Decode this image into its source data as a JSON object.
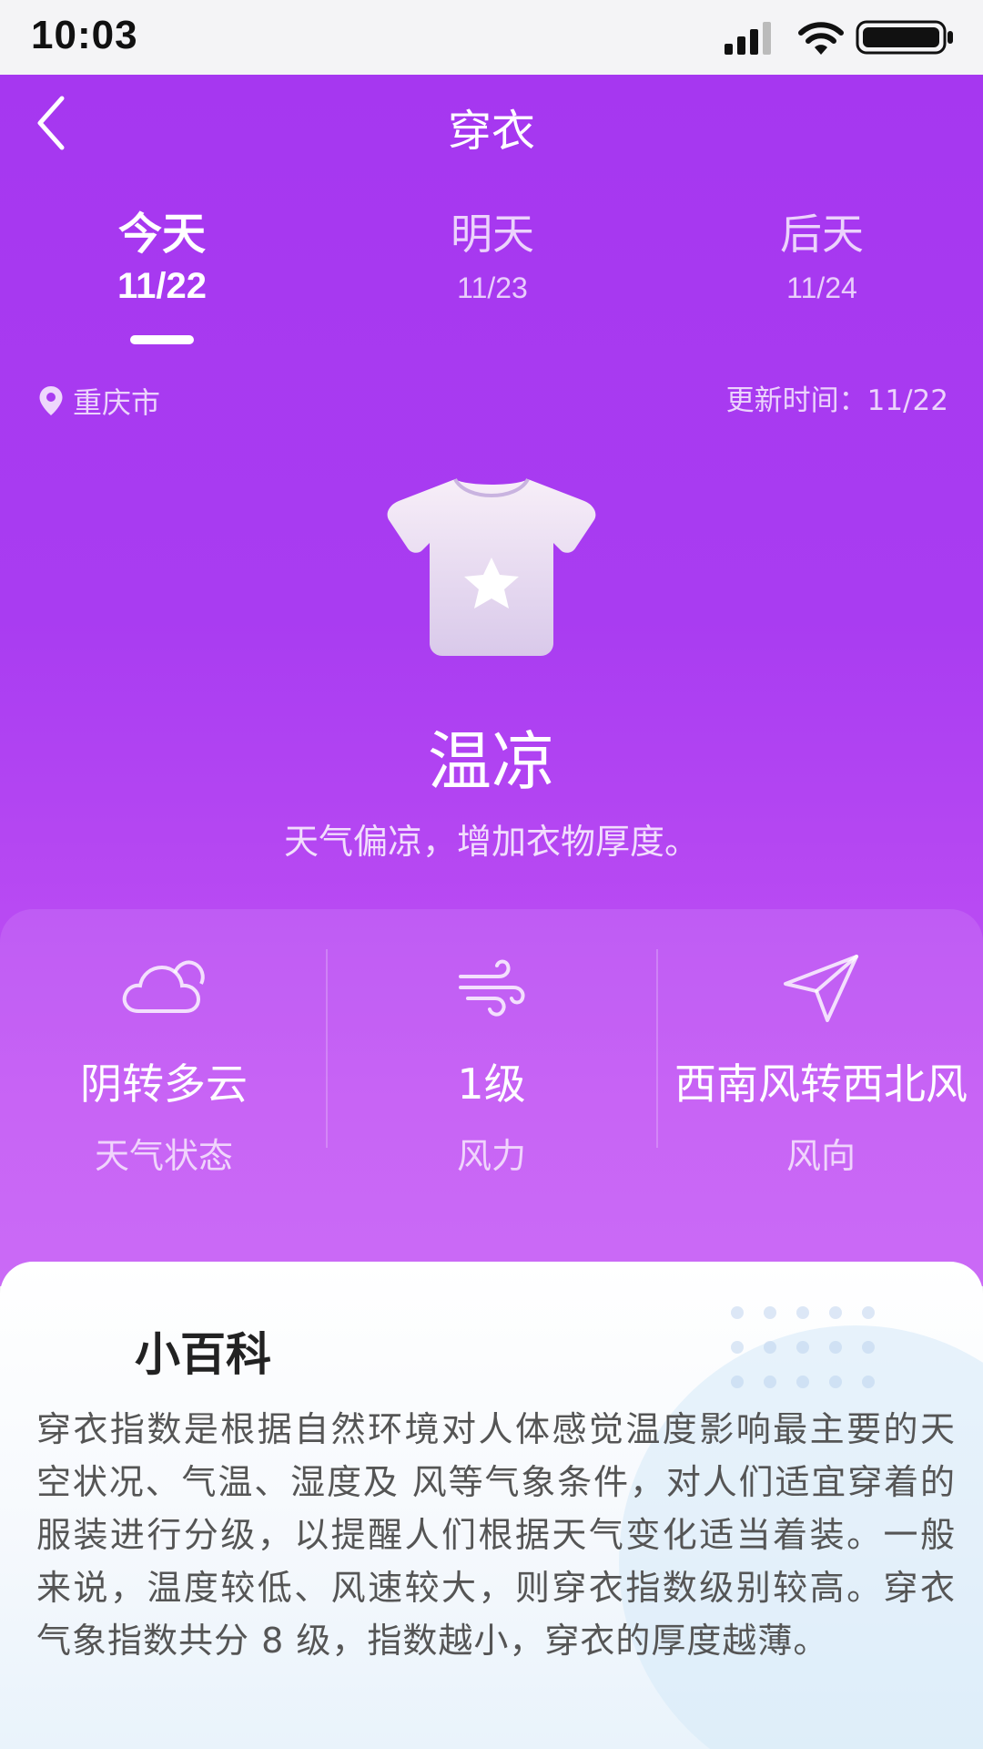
{
  "status_bar": {
    "time": "10:03"
  },
  "nav": {
    "title": "穿衣",
    "back_icon": "chevron-left-icon"
  },
  "tabs": [
    {
      "name": "今天",
      "date": "11/22",
      "active": true
    },
    {
      "name": "明天",
      "date": "11/23",
      "active": false
    },
    {
      "name": "后天",
      "date": "11/24",
      "active": false
    }
  ],
  "location": {
    "city": "重庆市",
    "icon": "location-pin-icon"
  },
  "update": {
    "text": "更新时间：11/22"
  },
  "index": {
    "icon": "tshirt-star-icon",
    "level": "温凉",
    "description": "天气偏凉，增加衣物厚度。"
  },
  "weather": [
    {
      "icon": "cloud-icon",
      "value": "阴转多云",
      "label": "天气状态"
    },
    {
      "icon": "wind-icon",
      "value": "1级",
      "label": "风力"
    },
    {
      "icon": "navigation-arrow-icon",
      "value": "西南风转西北风",
      "label": "风向"
    }
  ],
  "encyclopedia": {
    "title": "小百科",
    "text": "穿衣指数是根据自然环境对人体感觉温度影响最主要的天空状况、气温、湿度及 风等气象条件，对人们适宜穿着的服装进行分级，以提醒人们根据天气变化适当着装。一般来说，温度较低、风速较大，则穿衣指数级别较高。穿衣气象指数共分 8 级，指数越小，穿衣的厚度越薄。"
  },
  "colors": {
    "gradient_top": "#a637f0",
    "gradient_bottom": "#c45af5",
    "text_white": "#ffffff"
  }
}
